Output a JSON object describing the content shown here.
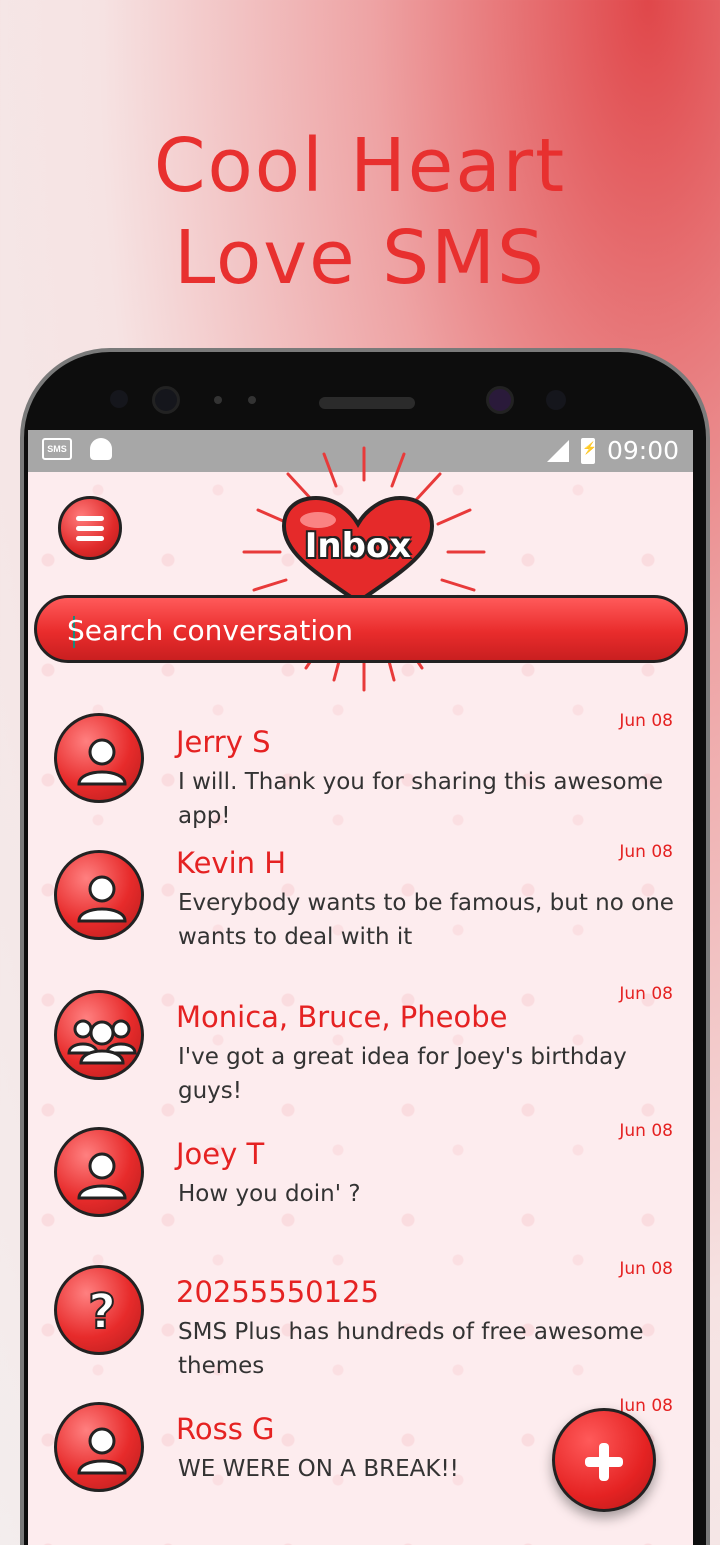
{
  "promo": {
    "title_line1": "Cool Heart",
    "title_line2": "Love SMS"
  },
  "statusbar": {
    "sms_chip": "SMS",
    "time": "09:00"
  },
  "header": {
    "title": "Inbox"
  },
  "search": {
    "placeholder": "Search conversation"
  },
  "conversations": [
    {
      "name": "Jerry S",
      "preview": "I will. Thank you for sharing this awesome app!",
      "date": "Jun 08",
      "avatar": "person-icon"
    },
    {
      "name": "Kevin H",
      "preview": "Everybody wants to be famous, but no one wants to deal with it",
      "date": "Jun 08",
      "avatar": "person-icon"
    },
    {
      "name": "Monica, Bruce, Pheobe",
      "preview": "I've got a great idea for Joey's birthday guys!",
      "date": "Jun 08",
      "avatar": "group-icon"
    },
    {
      "name": "Joey T",
      "preview": "How you doin' ?",
      "date": "Jun 08",
      "avatar": "person-icon"
    },
    {
      "name": "20255550125",
      "preview": "SMS Plus has hundreds of free awesome themes",
      "date": "Jun 08",
      "avatar": "unknown-contact-icon"
    },
    {
      "name": "Ross G",
      "preview": "WE WERE ON A BREAK!!",
      "date": "Jun 08",
      "avatar": "person-icon"
    }
  ],
  "colors": {
    "accent": "#e52222",
    "screen_bg": "#fdecee",
    "statusbar": "#a7a7a7"
  }
}
